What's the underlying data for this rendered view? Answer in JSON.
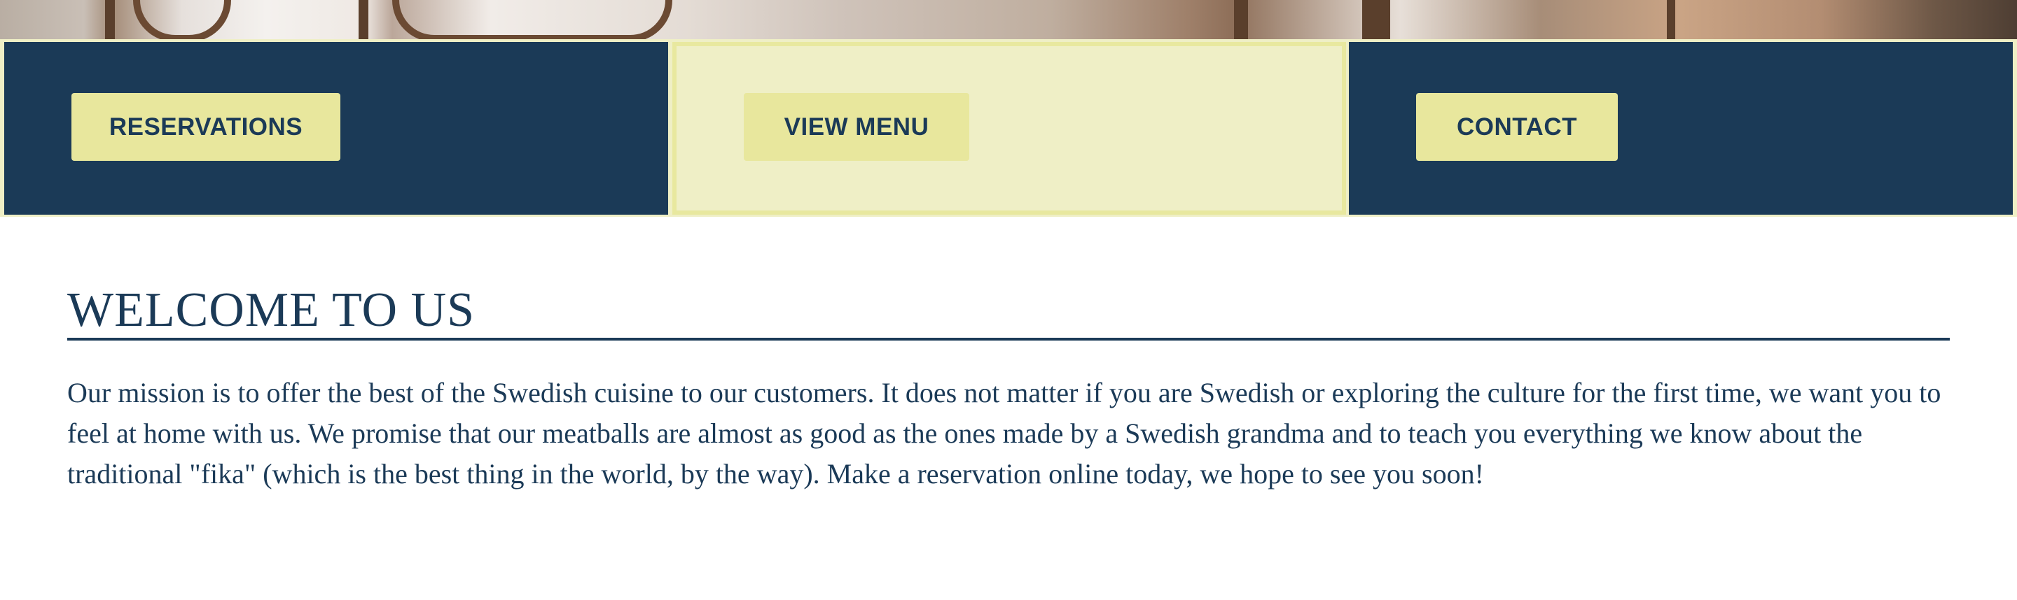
{
  "nav": {
    "reservations_label": "RESERVATIONS",
    "view_menu_label": "VIEW MENU",
    "contact_label": "CONTACT",
    "active_item": "VIEW MENU"
  },
  "welcome": {
    "title": "WELCOME TO US",
    "text": "Our mission is to offer the best of the Swedish cuisine to our customers. It does not matter if you are Swedish or exploring the culture for the first time, we want you to feel at home with us. We promise that our meatballs are almost as good as the ones made by a Swedish grandma and to teach you everything we know about the traditional \"fika\" (which is the best thing in the world, by the way). Make a reservation online today, we hope to see you soon!"
  },
  "colors": {
    "navy": "#1b3a57",
    "cream": "#efefc6",
    "button_yellow": "#e8e79d",
    "background": "#ffffff"
  }
}
